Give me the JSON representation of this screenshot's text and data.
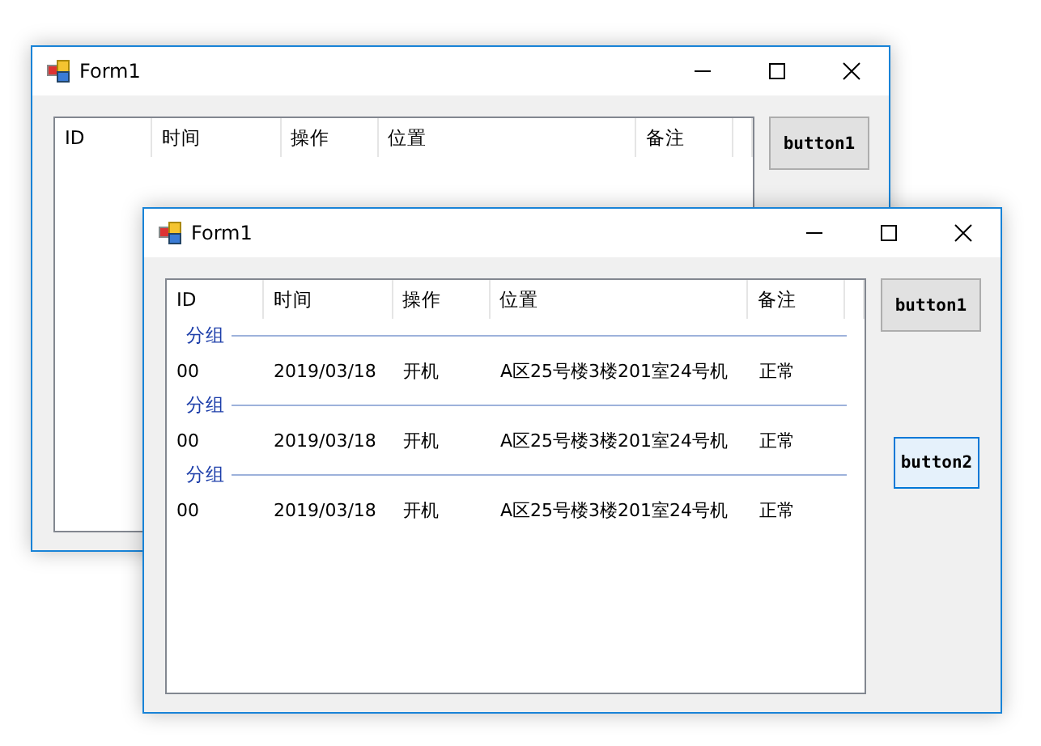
{
  "windows": [
    {
      "title": "Form1",
      "columns": [
        "ID",
        "时间",
        "操作",
        "位置",
        "备注"
      ],
      "buttons": [
        {
          "label": "button1",
          "focused": false
        }
      ]
    },
    {
      "title": "Form1",
      "columns": [
        "ID",
        "时间",
        "操作",
        "位置",
        "备注"
      ],
      "groups": [
        {
          "header": "分组",
          "rows": [
            [
              "00",
              "2019/03/18",
              "开机",
              "A区25号楼3楼201室24号机",
              "正常"
            ]
          ]
        },
        {
          "header": "分组",
          "rows": [
            [
              "00",
              "2019/03/18",
              "开机",
              "A区25号楼3楼201室24号机",
              "正常"
            ]
          ]
        },
        {
          "header": "分组",
          "rows": [
            [
              "00",
              "2019/03/18",
              "开机",
              "A区25号楼3楼201室24号机",
              "正常"
            ]
          ]
        }
      ],
      "buttons": [
        {
          "label": "button1",
          "focused": false
        },
        {
          "label": "button2",
          "focused": true
        }
      ]
    }
  ]
}
